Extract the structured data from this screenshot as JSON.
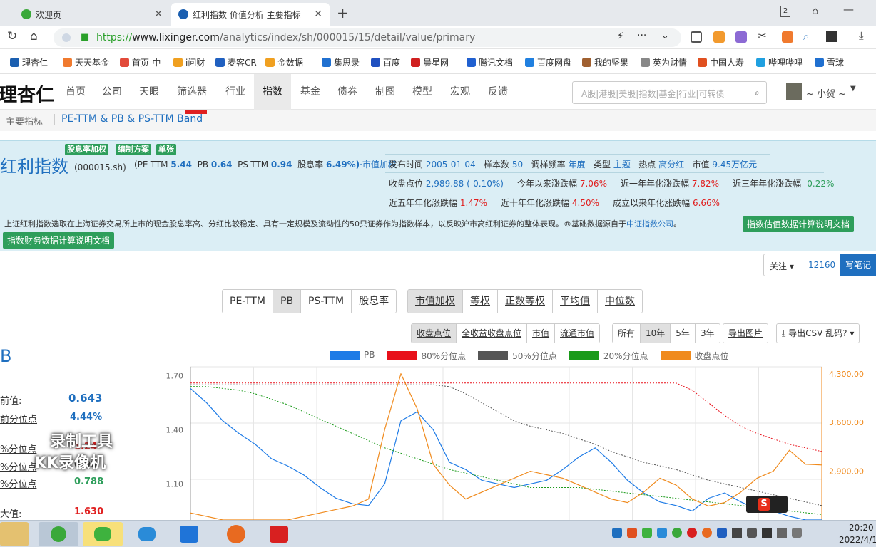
{
  "browser": {
    "tabs": [
      {
        "label": "欢迎页",
        "active": false
      },
      {
        "label": "红利指数 价值分析 主要指标",
        "active": true
      }
    ],
    "tab_count": "2",
    "url_prefix": "https://",
    "url_host": "www.lixinger.com",
    "url_path": "/analytics/index/sh/000015/15/detail/value/primary"
  },
  "bookmarks": [
    "理杏仁",
    "天天基金",
    "首页-中",
    "i问财",
    "麦客CR",
    "金数据",
    "集思录",
    "百度",
    "晨星网-",
    "腾讯文档",
    "百度网盘",
    "我的坚果",
    "英为财情",
    "中国人寿",
    "哔哩哔哩",
    "雪球 -"
  ],
  "site": {
    "logo": "理杏仁",
    "nav": [
      "首页",
      "公司",
      "天眼",
      "筛选器",
      "行业",
      "指数",
      "基金",
      "债券",
      "制图",
      "模型",
      "宏观",
      "反馈"
    ],
    "active_nav": "指数",
    "search_placeholder": "A股|港股|美股|指数|基金|行业|可转债",
    "user": "~ 小贺 ~"
  },
  "subnav": {
    "item1": "主要指标",
    "item2": "PE-TTM & PB & PS-TTM Band"
  },
  "index": {
    "tags": [
      "股息率加权",
      "编制方案",
      "单张"
    ],
    "name": "红利指数",
    "code": "(000015.sh)",
    "pe_label": "(PE-TTM",
    "pe": "5.44",
    "pb_label": "PB",
    "pb": "0.64",
    "ps_label": "PS-TTM",
    "ps": "0.94",
    "dy_label": "股息率",
    "dy": "6.49%)",
    "weight": "·市值加权",
    "release_label": "发布时间",
    "release": "2005-01-04",
    "sample_label": "样本数",
    "sample": "50",
    "adjust_label": "调样频率",
    "adjust": "年度",
    "type_label": "类型",
    "type": "主题",
    "hot_label": "热点",
    "hot": "高分红",
    "mcap_label": "市值",
    "mcap": "9.45万亿元",
    "close_label": "收盘点位",
    "close": "2,989.88 (-0.10%)",
    "ytd_label": "今年以来涨跌幅",
    "ytd": "7.06%",
    "y1_label": "近一年年化涨跌幅",
    "y1": "7.82%",
    "y3_label": "近三年年化涨跌幅",
    "y3": "-0.22%",
    "y5_label": "近五年年化涨跌幅",
    "y5": "1.47%",
    "y10_label": "近十年年化涨跌幅",
    "y10": "4.50%",
    "since_label": "成立以来年化涨跌幅",
    "since": "6.66%",
    "description": "上证红利指数选取在上海证券交易所上市的现金股息率高、分红比较稳定、具有一定规模及流动性的50只证券作为指数样本，以反映沪市高红利证券的整体表现。®基础数据源自于",
    "source_link": "中证指数公司",
    "valuation_doc": "指数估值数据计算说明文档",
    "finance_doc": "指数财务数据计算说明文档"
  },
  "follow": {
    "label": "关注",
    "count": "12160",
    "note": "写笔记"
  },
  "metric_tabs": [
    "PE-TTM",
    "PB",
    "PS-TTM",
    "股息率"
  ],
  "weight_tabs": [
    "市值加权",
    "等权",
    "正数等权",
    "平均值",
    "中位数"
  ],
  "price_tabs": [
    "收盘点位",
    "全收益收盘点位",
    "市值",
    "流通市值"
  ],
  "range_tabs": [
    "所有",
    "10年",
    "5年",
    "3年"
  ],
  "export_image": "导出图片",
  "export_csv": "导出CSV 乱码?",
  "stats": {
    "title": "B",
    "current_label": "前值:",
    "current": "0.643",
    "pct_label": "前分位点",
    "pct": "4.44%",
    "p80_label": "%分位点",
    "p80": "1.24",
    "p50_label": "%分位点",
    "p50": "0.98",
    "p20_label": "%分位点",
    "p20": "0.788",
    "max_label": "大值:",
    "max": "1.630"
  },
  "watermark": {
    "line1": "录制工具",
    "line2": "KK录像机"
  },
  "clock": {
    "time": "20:20",
    "date": "2022/4/1"
  },
  "colors": {
    "pb": "#1e7be6",
    "p80": "#e8101a",
    "p50": "#555555",
    "p20": "#1a9a1a",
    "close": "#f08a1c"
  },
  "chart_data": {
    "type": "line",
    "legend": [
      "PB",
      "80%分位点",
      "50%分位点",
      "20%分位点",
      "收盘点位"
    ],
    "y_left_ticks": [
      "1.70",
      "1.40",
      "1.10"
    ],
    "y_right_ticks": [
      "4,300.00",
      "3,600.00",
      "2,900.00"
    ],
    "ylim_left": [
      0.9,
      1.75
    ],
    "ylim_right": [
      2200,
      4400
    ],
    "series": [
      {
        "name": "PB",
        "values": [
          1.63,
          1.55,
          1.45,
          1.38,
          1.32,
          1.24,
          1.2,
          1.15,
          1.08,
          1.02,
          0.99,
          0.98,
          1.1,
          1.45,
          1.5,
          1.4,
          1.22,
          1.18,
          1.12,
          1.1,
          1.08,
          1.1,
          1.12,
          1.18,
          1.25,
          1.3,
          1.22,
          1.12,
          1.05,
          1.0,
          0.98,
          0.95,
          1.02,
          1.05,
          1.0,
          0.96,
          0.95,
          0.92,
          0.88,
          0.85
        ]
      },
      {
        "name": "80%分位点",
        "values": [
          1.66,
          1.66,
          1.66,
          1.66,
          1.66,
          1.66,
          1.66,
          1.66,
          1.66,
          1.66,
          1.66,
          1.66,
          1.66,
          1.66,
          1.66,
          1.66,
          1.66,
          1.66,
          1.66,
          1.66,
          1.66,
          1.66,
          1.66,
          1.66,
          1.66,
          1.66,
          1.66,
          1.66,
          1.66,
          1.66,
          1.66,
          1.62,
          1.55,
          1.48,
          1.42,
          1.38,
          1.35,
          1.32,
          1.3,
          1.28
        ]
      },
      {
        "name": "50%分位点",
        "values": [
          1.65,
          1.65,
          1.65,
          1.65,
          1.65,
          1.65,
          1.65,
          1.65,
          1.65,
          1.65,
          1.65,
          1.65,
          1.65,
          1.65,
          1.65,
          1.65,
          1.64,
          1.6,
          1.55,
          1.5,
          1.45,
          1.42,
          1.4,
          1.38,
          1.35,
          1.32,
          1.28,
          1.25,
          1.22,
          1.2,
          1.18,
          1.15,
          1.12,
          1.1,
          1.08,
          1.06,
          1.04,
          1.02,
          1.0,
          0.98
        ]
      },
      {
        "name": "20%分位点",
        "values": [
          1.64,
          1.64,
          1.63,
          1.62,
          1.6,
          1.57,
          1.54,
          1.5,
          1.46,
          1.42,
          1.38,
          1.34,
          1.3,
          1.27,
          1.24,
          1.21,
          1.18,
          1.16,
          1.14,
          1.12,
          1.1,
          1.08,
          1.08,
          1.08,
          1.08,
          1.07,
          1.06,
          1.05,
          1.04,
          1.03,
          1.02,
          1.01,
          1.0,
          0.99,
          0.98,
          0.97,
          0.96,
          0.95,
          0.94,
          0.93
        ]
      },
      {
        "name": "收盘点位",
        "values": [
          2300,
          2250,
          2200,
          2200,
          2200,
          2200,
          2200,
          2250,
          2300,
          2350,
          2400,
          2500,
          3500,
          4300,
          3800,
          3000,
          2700,
          2500,
          2600,
          2700,
          2800,
          2900,
          2850,
          2800,
          2700,
          2600,
          2500,
          2450,
          2600,
          2800,
          2700,
          2500,
          2400,
          2450,
          2600,
          2800,
          2900,
          3200,
          3000,
          2990
        ]
      }
    ]
  }
}
